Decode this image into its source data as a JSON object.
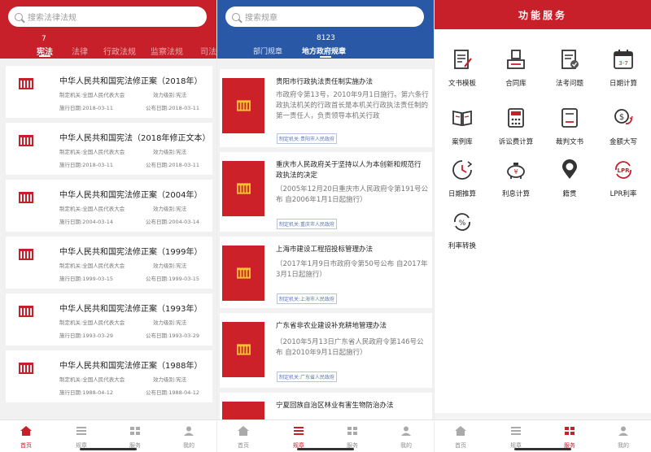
{
  "colors": {
    "red": "#c8202b",
    "blue": "#2958a7"
  },
  "panel1": {
    "search_placeholder": "搜索法律法规",
    "tab_count": "7",
    "tabs": [
      "宪法",
      "法律",
      "行政法规",
      "监察法规",
      "司法"
    ],
    "items": [
      {
        "title": "中华人民共和国宪法修正案（2018年）",
        "org": "制定机关:全国人民代表大会",
        "validity": "效力级别:宪法",
        "exec": "施行日期:2018-03-11",
        "pub": "公布日期:2018-03-11"
      },
      {
        "title": "中华人民共和国宪法（2018年修正文本）",
        "org": "制定机关:全国人民代表大会",
        "validity": "效力级别:宪法",
        "exec": "施行日期:2018-03-11",
        "pub": "公布日期:2018-03-11"
      },
      {
        "title": "中华人民共和国宪法修正案（2004年）",
        "org": "制定机关:全国人民代表大会",
        "validity": "效力级别:宪法",
        "exec": "施行日期:2004-03-14",
        "pub": "公布日期:2004-03-14"
      },
      {
        "title": "中华人民共和国宪法修正案（1999年）",
        "org": "制定机关:全国人民代表大会",
        "validity": "效力级别:宪法",
        "exec": "施行日期:1999-03-15",
        "pub": "公布日期:1999-03-15"
      },
      {
        "title": "中华人民共和国宪法修正案（1993年）",
        "org": "制定机关:全国人民代表大会",
        "validity": "效力级别:宪法",
        "exec": "施行日期:1993-03-29",
        "pub": "公布日期:1993-03-29"
      },
      {
        "title": "中华人民共和国宪法修正案（1988年）",
        "org": "制定机关:全国人民代表大会",
        "validity": "效力级别:宪法",
        "exec": "施行日期:1988-04-12",
        "pub": "公布日期:1988-04-12"
      }
    ],
    "nav": [
      "首页",
      "规章",
      "服务",
      "我的"
    ]
  },
  "panel2": {
    "search_placeholder": "搜索规章",
    "tab_count": "8123",
    "tabs": [
      "部门规章",
      "地方政府规章"
    ],
    "items": [
      {
        "title": "贵阳市行政执法责任制实施办法",
        "sub": "市政府令第13号，2010年9月1日施行。第六条行政执法机关的行政首长是本机关行政执法责任制的第一责任人，负责领导本机关行政",
        "tag": "制定机关:贵阳市人民政府"
      },
      {
        "title": "重庆市人民政府关于坚持以人为本创新和规范行政执法的决定",
        "sub": "（2005年12月20日重庆市人民政府令第191号公布 自2006年1月1日起施行）",
        "tag": "制定机关:重庆市人民政府"
      },
      {
        "title": "上海市建设工程招投标管理办法",
        "sub": "（2017年1月9日市政府令第50号公布 自2017年3月1日起施行）",
        "tag": "制定机关:上海市人民政府"
      },
      {
        "title": "广东省非农业建设补充耕地管理办法",
        "sub": "（2010年5月13日广东省人民政府令第146号公布 自2010年9月1日起施行）",
        "tag": "制定机关:广东省人民政府"
      },
      {
        "title": "宁夏回族自治区林业有害生物防治办法"
      }
    ],
    "nav": [
      "首页",
      "规章",
      "服务",
      "我的"
    ]
  },
  "panel3": {
    "title": "功能服务",
    "services": [
      "文书模板",
      "合同库",
      "法考问题",
      "日期计算",
      "案例库",
      "诉讼费计算",
      "裁判文书",
      "金额大写",
      "日期推算",
      "利息计算",
      "籍贯",
      "LPR利率",
      "利率转换"
    ],
    "date_icon_text": "3-7",
    "lpr_icon_text": "LPR",
    "rate_icon_text": "%",
    "nav": [
      "首页",
      "规章",
      "服务",
      "我的"
    ]
  }
}
